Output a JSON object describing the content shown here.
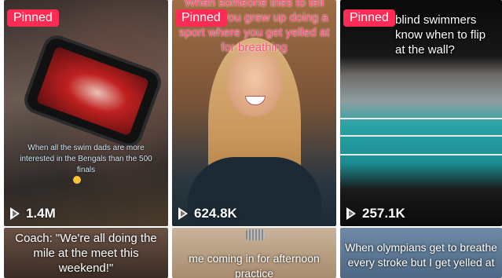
{
  "grid": {
    "videos": [
      {
        "pinned_label": "Pinned",
        "caption": "When all the swim dads are more interested in the Bengals than the 500 finals",
        "views": "1.4M"
      },
      {
        "pinned_label": "Pinned",
        "caption": "When someone tries to tell you but you grew up doing a sport where you get yelled at for breathing",
        "views": "624.8K"
      },
      {
        "pinned_label": "Pinned",
        "caption": "blind swimmers know when to flip at the wall?",
        "views": "257.1K"
      },
      {
        "caption": "Coach: \"We're all doing the mile at the meet this weekend!\""
      },
      {
        "caption": "me coming in for afternoon practice"
      },
      {
        "caption": "When olympians get to breathe every stroke but I get yelled at"
      }
    ]
  },
  "colors": {
    "pinned_bg": "#fe2c55",
    "views_text": "#ffffff"
  },
  "icons": {
    "views": "play-icon"
  }
}
